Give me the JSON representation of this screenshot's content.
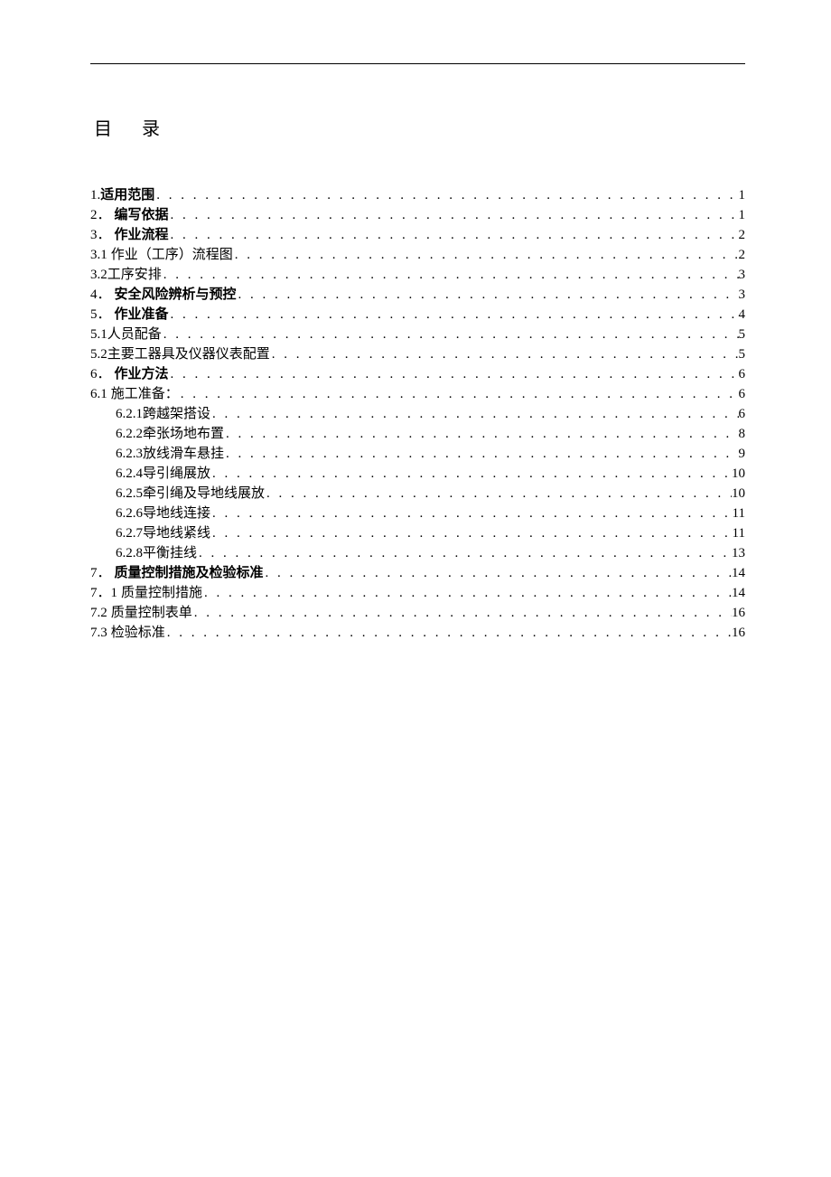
{
  "title": "目 录",
  "dots": ". . . . . . . . . . . . . . . . . . . . . . . . . . . . . . . . . . . . . . . . . . . . . . . . . . . . . . . . . . . . . . . . . . . . . . . . . . . . . . . . . . . . . . . . . . . . . . . . . . . . . . . . . . . . . . . . . . . . . . . .",
  "items": [
    {
      "num": "1.",
      "text": "适用范围",
      "page": "1",
      "bold": true,
      "sub": false,
      "spaced": false
    },
    {
      "num": "2．",
      "text": "编写依据",
      "page": "1",
      "bold": true,
      "sub": false,
      "spaced": true
    },
    {
      "num": "3．",
      "text": "作业流程",
      "page": "2",
      "bold": true,
      "sub": false,
      "spaced": true
    },
    {
      "num": "3.1",
      "text": "作业（工序）流程图 ",
      "page": "2",
      "bold": false,
      "sub": false,
      "spaced": true
    },
    {
      "num": "3.2 ",
      "text": "工序安排",
      "page": "3",
      "bold": false,
      "sub": false,
      "spaced": false
    },
    {
      "num": "4．",
      "text": "安全风险辨析与预控",
      "page": "3",
      "bold": true,
      "sub": false,
      "spaced": true
    },
    {
      "num": "5．",
      "text": "作业准备",
      "page": "4",
      "bold": true,
      "sub": false,
      "spaced": true
    },
    {
      "num": "5.1 ",
      "text": "人员配备",
      "page": "5",
      "bold": false,
      "sub": false,
      "spaced": false
    },
    {
      "num": "5.2 ",
      "text": "主要工器具及仪器仪表配置",
      "page": "5",
      "bold": false,
      "sub": false,
      "spaced": false
    },
    {
      "num": "6．",
      "text": "作业方法",
      "page": "6",
      "bold": true,
      "sub": false,
      "spaced": true
    },
    {
      "num": "6.1",
      "text": "施工准备：  ",
      "page": "6",
      "bold": false,
      "sub": false,
      "spaced": true
    },
    {
      "num": "6.2.1 ",
      "text": "跨越架搭设",
      "page": "6",
      "bold": false,
      "sub": true,
      "spaced": false
    },
    {
      "num": "6.2.2 ",
      "text": "牵张场地布置",
      "page": "8",
      "bold": false,
      "sub": true,
      "spaced": false
    },
    {
      "num": "6.2.3 ",
      "text": "放线滑车悬挂",
      "page": "9",
      "bold": false,
      "sub": true,
      "spaced": false
    },
    {
      "num": "6.2.4 ",
      "text": "导引绳展放",
      "page": "10",
      "bold": false,
      "sub": true,
      "spaced": false
    },
    {
      "num": "6.2.5 ",
      "text": "牵引绳及导地线展放",
      "page": "10",
      "bold": false,
      "sub": true,
      "spaced": false
    },
    {
      "num": "6.2.6 ",
      "text": "导地线连接",
      "page": "11",
      "bold": false,
      "sub": true,
      "spaced": false
    },
    {
      "num": "6.2.7 ",
      "text": "导地线紧线",
      "page": "11",
      "bold": false,
      "sub": true,
      "spaced": false
    },
    {
      "num": "6.2.8 ",
      "text": "平衡挂线",
      "page": "13",
      "bold": false,
      "sub": true,
      "spaced": false
    },
    {
      "num": "7．",
      "text": "质量控制措施及检验标准",
      "page": "14",
      "bold": true,
      "sub": false,
      "spaced": true
    },
    {
      "num": "7．1",
      "text": "质量控制措施 ",
      "page": "14",
      "bold": false,
      "sub": false,
      "spaced": true
    },
    {
      "num": "7.2",
      "text": "质量控制表单 ",
      "page": "16",
      "bold": false,
      "sub": false,
      "spaced": true
    },
    {
      "num": "7.3",
      "text": "检验标准 ",
      "page": "16",
      "bold": false,
      "sub": false,
      "spaced": true
    }
  ]
}
